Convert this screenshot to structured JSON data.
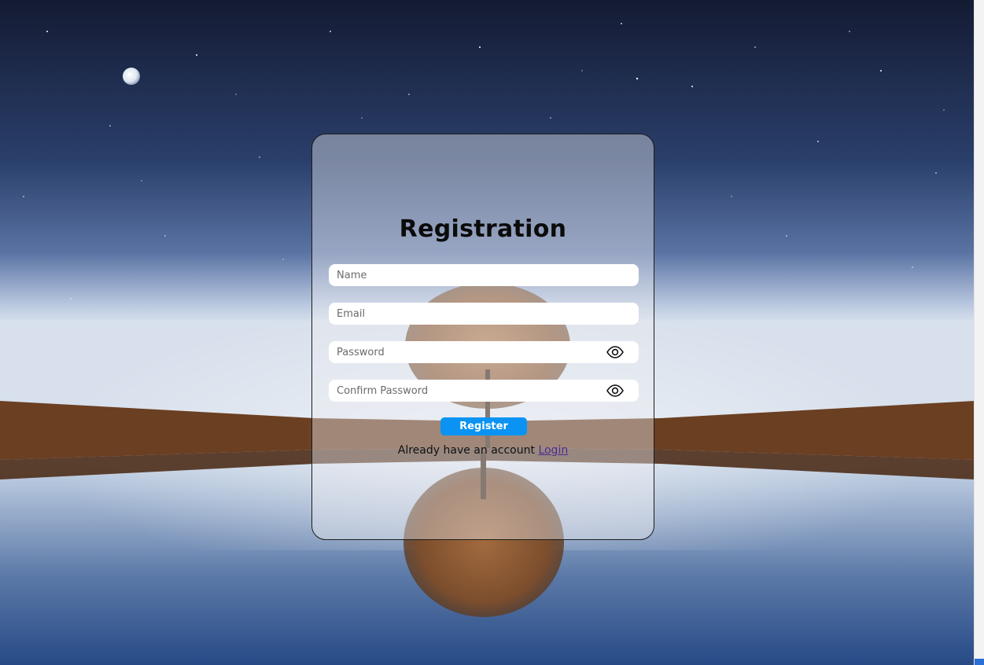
{
  "form": {
    "title": "Registration",
    "name_placeholder": "Name",
    "email_placeholder": "Email",
    "password_placeholder": "Password",
    "confirm_password_placeholder": "Confirm Password",
    "register_label": "Register",
    "footer_text": "Already have an account",
    "login_link_label": "Login",
    "show_password_icon": "eye-icon",
    "show_confirm_password_icon": "eye-icon"
  },
  "colors": {
    "button": "#0a93f2",
    "link": "#4b2c8f",
    "sky_top": "#141b33",
    "sky_horizon": "#c3d0e4"
  }
}
